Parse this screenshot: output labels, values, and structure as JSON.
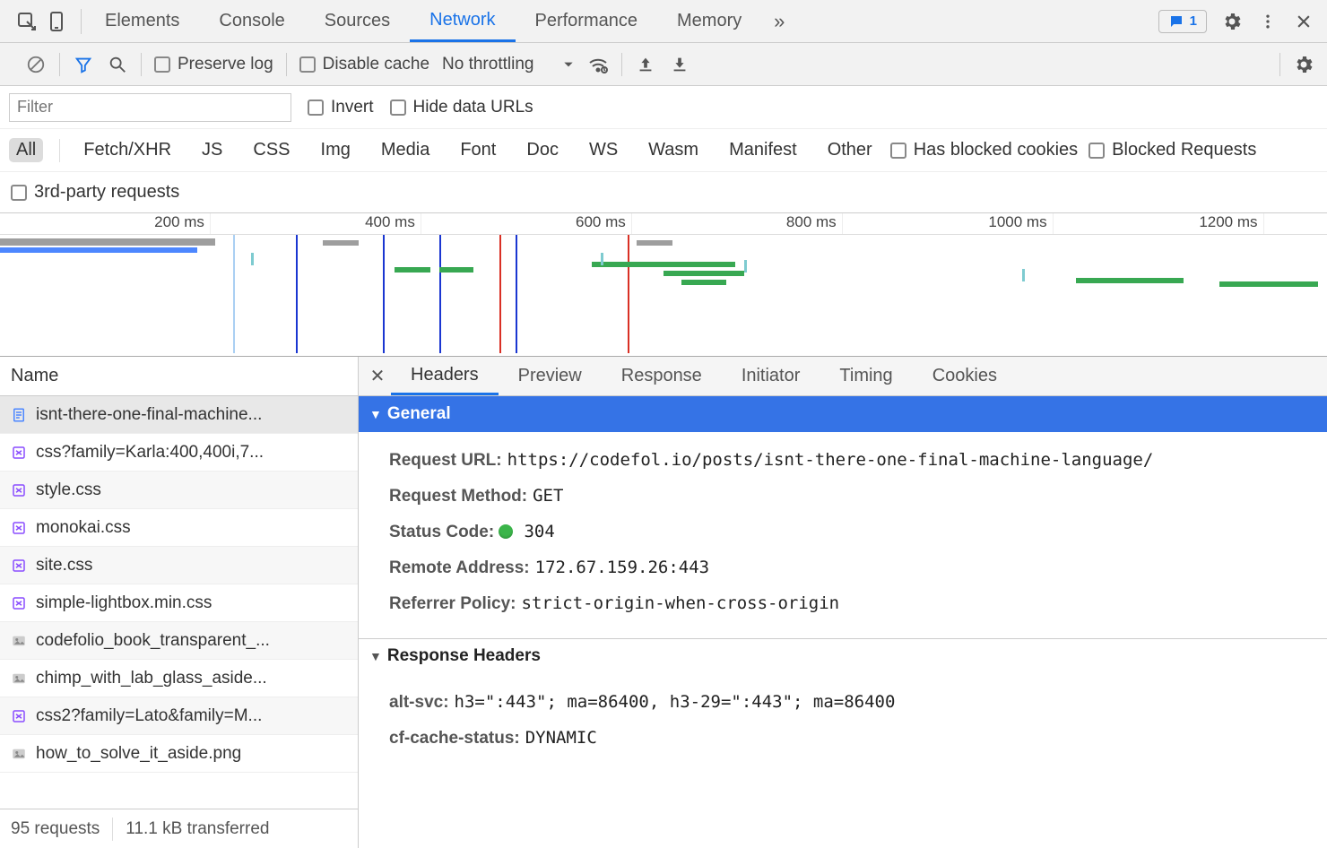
{
  "mainTabs": {
    "items": [
      "Elements",
      "Console",
      "Sources",
      "Network",
      "Performance",
      "Memory"
    ],
    "active": "Network",
    "issuesCount": "1"
  },
  "toolbar": {
    "preserveLog": "Preserve log",
    "disableCache": "Disable cache",
    "throttling": "No throttling"
  },
  "filter": {
    "placeholder": "Filter",
    "invert": "Invert",
    "hideDataUrls": "Hide data URLs"
  },
  "types": {
    "items": [
      "All",
      "Fetch/XHR",
      "JS",
      "CSS",
      "Img",
      "Media",
      "Font",
      "Doc",
      "WS",
      "Wasm",
      "Manifest",
      "Other"
    ],
    "active": "All",
    "hasBlockedCookies": "Has blocked cookies",
    "blockedRequests": "Blocked Requests"
  },
  "tpRow": {
    "thirdParty": "3rd-party requests"
  },
  "timeline": {
    "ticks": [
      "200 ms",
      "400 ms",
      "600 ms",
      "800 ms",
      "1000 ms",
      "1200 ms"
    ]
  },
  "reqList": {
    "header": "Name",
    "items": [
      {
        "name": "isnt-there-one-final-machine...",
        "icon": "doc"
      },
      {
        "name": "css?family=Karla:400,400i,7...",
        "icon": "css"
      },
      {
        "name": "style.css",
        "icon": "css"
      },
      {
        "name": "monokai.css",
        "icon": "css"
      },
      {
        "name": "site.css",
        "icon": "css"
      },
      {
        "name": "simple-lightbox.min.css",
        "icon": "css"
      },
      {
        "name": "codefolio_book_transparent_...",
        "icon": "img"
      },
      {
        "name": "chimp_with_lab_glass_aside...",
        "icon": "img"
      },
      {
        "name": "css2?family=Lato&family=M...",
        "icon": "css"
      },
      {
        "name": "how_to_solve_it_aside.png",
        "icon": "img"
      }
    ],
    "selectedIndex": 0,
    "footer": {
      "requests": "95 requests",
      "transferred": "11.1 kB transferred"
    }
  },
  "details": {
    "tabs": [
      "Headers",
      "Preview",
      "Response",
      "Initiator",
      "Timing",
      "Cookies"
    ],
    "active": "Headers",
    "general": {
      "title": "General",
      "rows": {
        "requestUrlLabel": "Request URL:",
        "requestUrl": "https://codefol.io/posts/isnt-there-one-final-machine-language/",
        "requestMethodLabel": "Request Method:",
        "requestMethod": "GET",
        "statusCodeLabel": "Status Code:",
        "statusCode": "304",
        "remoteAddressLabel": "Remote Address:",
        "remoteAddress": "172.67.159.26:443",
        "referrerPolicyLabel": "Referrer Policy:",
        "referrerPolicy": "strict-origin-when-cross-origin"
      }
    },
    "responseHeaders": {
      "title": "Response Headers",
      "rows": {
        "altSvcLabel": "alt-svc:",
        "altSvc": "h3=\":443\"; ma=86400, h3-29=\":443\"; ma=86400",
        "cfCacheLabel": "cf-cache-status:",
        "cfCache": "DYNAMIC"
      }
    }
  }
}
